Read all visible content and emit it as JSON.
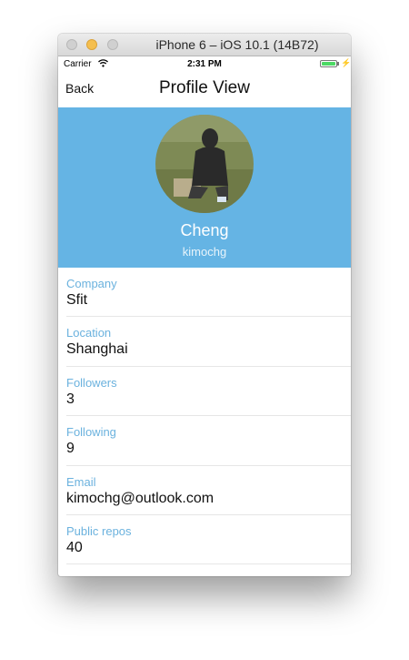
{
  "window": {
    "title": "iPhone 6 – iOS 10.1 (14B72)"
  },
  "status_bar": {
    "carrier": "Carrier",
    "time": "2:31 PM",
    "wifi_icon": "wifi-icon",
    "battery_icon": "battery-icon"
  },
  "nav": {
    "back_label": "Back",
    "title": "Profile View"
  },
  "profile": {
    "name": "Cheng",
    "username": "kimochg",
    "header_color": "#65b4e4"
  },
  "fields": [
    {
      "label": "Company",
      "value": "Sfit"
    },
    {
      "label": "Location",
      "value": "Shanghai"
    },
    {
      "label": "Followers",
      "value": "3"
    },
    {
      "label": "Following",
      "value": "9"
    },
    {
      "label": "Email",
      "value": "kimochg@outlook.com"
    },
    {
      "label": "Public repos",
      "value": "40"
    }
  ]
}
